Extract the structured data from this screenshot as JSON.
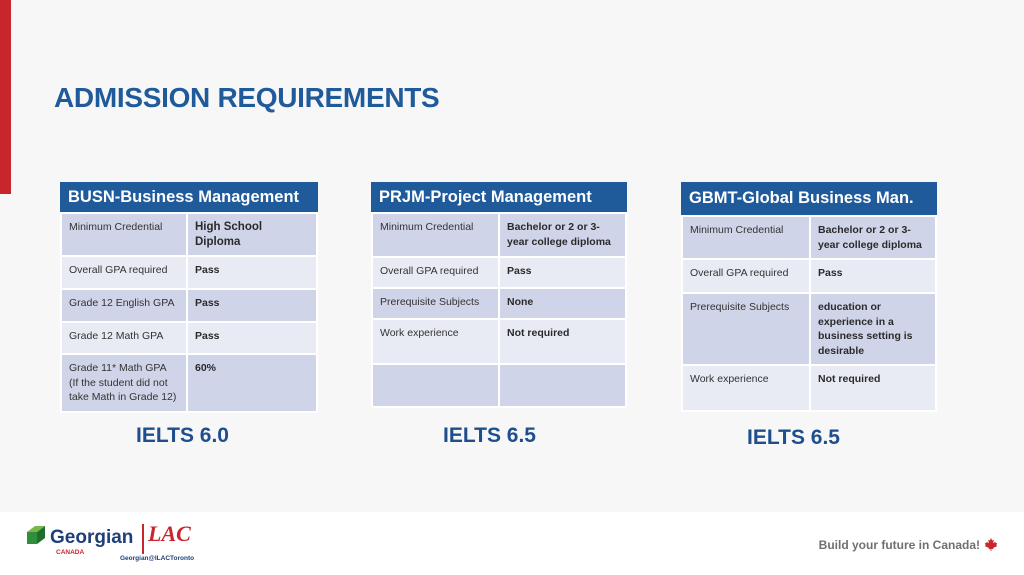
{
  "title": "ADMISSION REQUIREMENTS",
  "programs": [
    {
      "name": "BUSN-Business Management",
      "rows": [
        [
          "Minimum Credential",
          "High School Diploma"
        ],
        [
          "Overall GPA required",
          "Pass"
        ],
        [
          "Grade 12 English GPA",
          "Pass"
        ],
        [
          "Grade 12 Math GPA",
          "Pass"
        ],
        [
          "Grade 11* Math GPA\n(If the student did not take Math in Grade 12)",
          "60%"
        ]
      ],
      "ielts": "IELTS 6.0"
    },
    {
      "name": "PRJM-Project Management",
      "rows": [
        [
          "Minimum Credential",
          "Bachelor or 2 or 3-year college diploma"
        ],
        [
          "Overall GPA required",
          "Pass"
        ],
        [
          "Prerequisite Subjects",
          "None"
        ],
        [
          "Work experience",
          "Not required"
        ],
        [
          "",
          ""
        ]
      ],
      "ielts": "IELTS 6.5"
    },
    {
      "name": "GBMT-Global Business Man.",
      "rows": [
        [
          "Minimum Credential",
          "Bachelor or 2 or 3-year college diploma"
        ],
        [
          "Overall GPA required",
          "Pass"
        ],
        [
          "Prerequisite Subjects",
          "education or experience in a business setting is desirable"
        ],
        [
          "Work experience",
          "Not required"
        ]
      ],
      "ielts": "IELTS 6.5"
    }
  ],
  "footer": {
    "logo_name": "Georgian",
    "logo_sub": "CANADA",
    "logo_partner": "LAC",
    "logo_partner_sub": "Georgian@ILACToronto",
    "tagline": "Build your future in Canada!"
  },
  "colors": {
    "accent_red": "#c8262c",
    "header_blue": "#1f5a9a",
    "row_dark": "#cfd4e8",
    "row_light": "#e9ebf4"
  },
  "icons": [
    "georgian-logo-icon",
    "maple-leaf-icon"
  ]
}
